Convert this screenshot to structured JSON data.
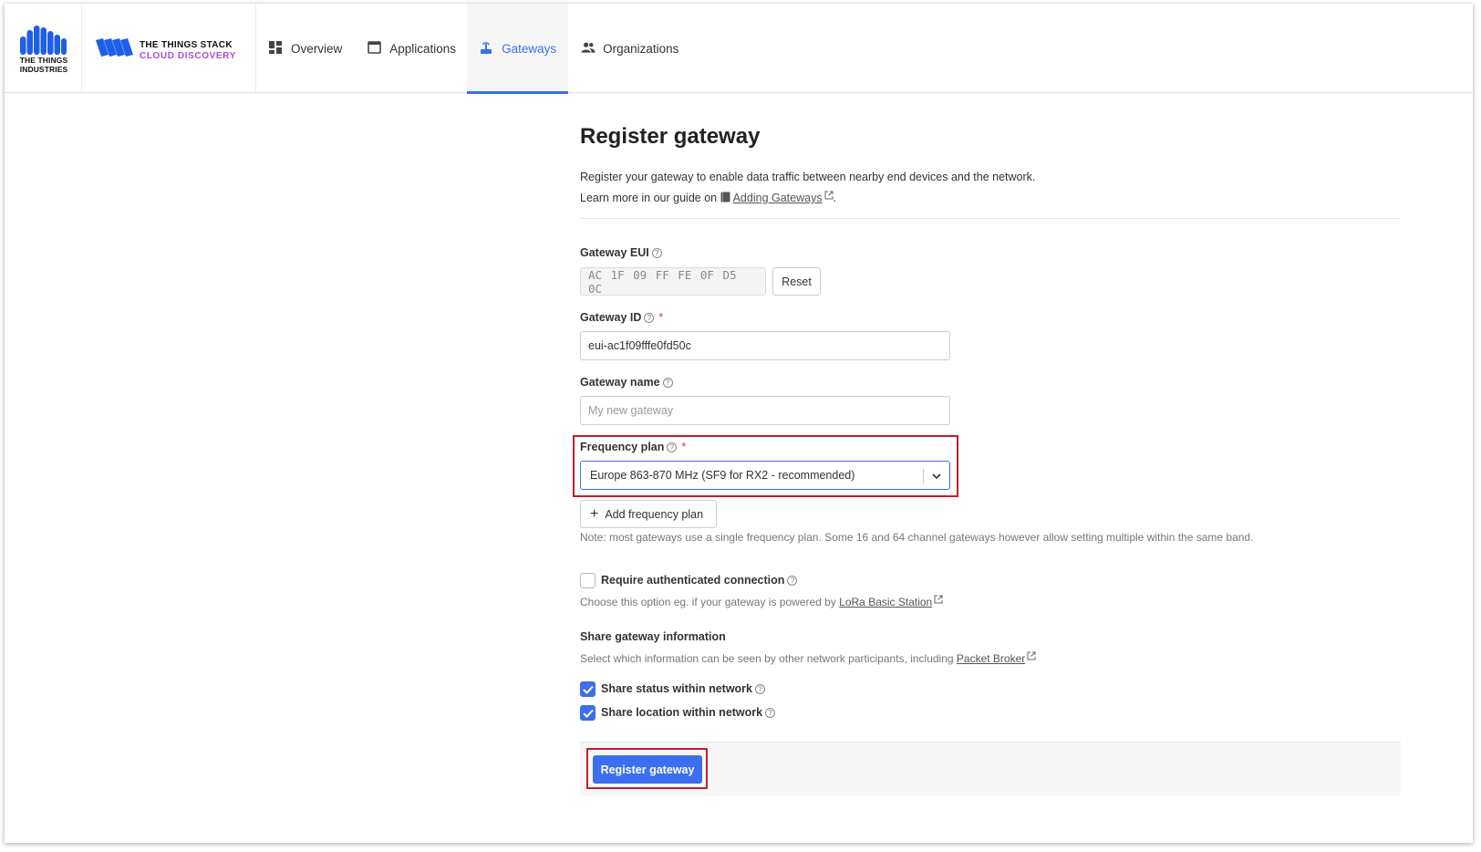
{
  "brand": {
    "tti_name": "THE THINGS INDUSTRIES",
    "stack_line1": "THE THINGS STACK",
    "stack_line2": "CLOUD DISCOVERY"
  },
  "nav": [
    {
      "label": "Overview",
      "icon": "dashboard-icon",
      "active": false
    },
    {
      "label": "Applications",
      "icon": "application-icon",
      "active": false
    },
    {
      "label": "Gateways",
      "icon": "gateway-icon",
      "active": true
    },
    {
      "label": "Organizations",
      "icon": "organization-icon",
      "active": false
    }
  ],
  "page": {
    "title": "Register gateway",
    "desc_line1": "Register your gateway to enable data traffic between nearby end devices and the network.",
    "desc_line2_prefix": "Learn more in our guide on",
    "desc_link": "Adding Gateways",
    "desc_suffix": "."
  },
  "form": {
    "eui_label": "Gateway EUI",
    "eui_value": "AC 1F 09 FF FE 0F D5 0C",
    "reset_label": "Reset",
    "id_label": "Gateway ID",
    "id_value": "eui-ac1f09fffe0fd50c",
    "name_label": "Gateway name",
    "name_placeholder": "My new gateway",
    "freq_label": "Frequency plan",
    "freq_value": "Europe 863-870 MHz (SF9 for RX2 - recommended)",
    "add_freq_label": "Add frequency plan",
    "freq_note": "Note: most gateways use a single frequency plan. Some 16 and 64 channel gateways however allow setting multiple within the same band.",
    "auth_label": "Require authenticated connection",
    "auth_checked": false,
    "auth_note_prefix": "Choose this option eg. if your gateway is powered by",
    "auth_note_link": "LoRa Basic Station",
    "share_heading": "Share gateway information",
    "share_note_prefix": "Select which information can be seen by other network participants, including",
    "share_note_link": "Packet Broker",
    "share_status_label": "Share status within network",
    "share_status_checked": true,
    "share_location_label": "Share location within network",
    "share_location_checked": true,
    "submit_label": "Register gateway"
  },
  "colors": {
    "accent": "#3b6ff0",
    "highlight": "#c41e2a",
    "brand_purple": "#b04bd8"
  }
}
